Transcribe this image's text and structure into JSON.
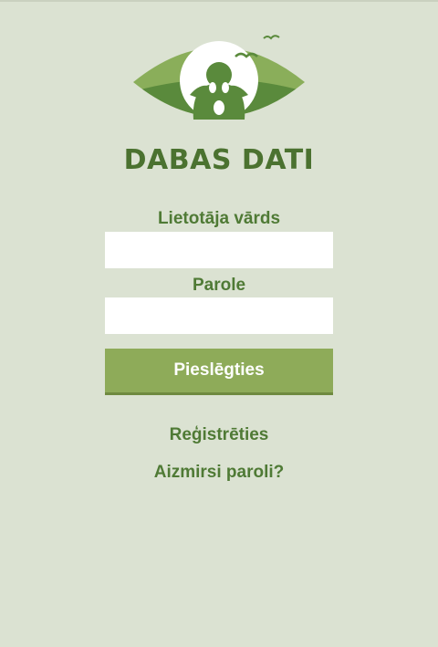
{
  "app": {
    "brand": "DABAS DATI"
  },
  "login": {
    "username_label": "Lietotāja vārds",
    "username_value": "",
    "password_label": "Parole",
    "password_value": "",
    "submit_label": "Pieslēgties",
    "register_label": "Reģistrēties",
    "forgot_label": "Aizmirsi paroli?"
  },
  "colors": {
    "background": "#dbe2d2",
    "primary_green": "#4f7a35",
    "button_green": "#8eab59",
    "logo_light": "#8aae5a",
    "logo_dark": "#5a8a3c"
  },
  "icons": {
    "logo": "eye-with-owl-logo"
  }
}
